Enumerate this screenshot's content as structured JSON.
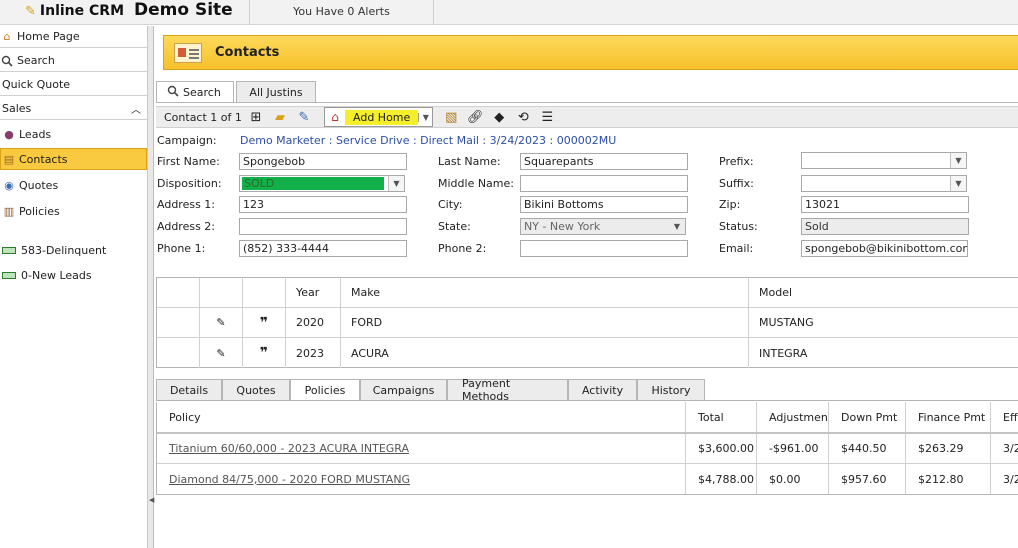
{
  "topbar": {
    "brand": "Inline CRM",
    "site": "Demo Site",
    "alerts": "You Have 0 Alerts"
  },
  "sidebar": {
    "home": "Home Page",
    "search": "Search",
    "quick_quote": "Quick Quote",
    "sales": "Sales",
    "leads": "Leads",
    "contacts": "Contacts",
    "quotes": "Quotes",
    "policies": "Policies",
    "delinquent": "583-Delinquent",
    "new_leads": "0-New Leads"
  },
  "header": {
    "title": "Contacts"
  },
  "top_tabs": {
    "search": "Search",
    "all_justins": "All Justins"
  },
  "toolbar": {
    "record": "Contact 1 of 1",
    "add_home": "Add Home"
  },
  "form": {
    "campaign_label": "Campaign:",
    "campaign_value": "Demo Marketer : Service Drive : Direct Mail : 3/24/2023 : 000002MU",
    "first_name_label": "First Name:",
    "first_name": "Spongebob",
    "last_name_label": "Last Name:",
    "last_name": "Squarepants",
    "prefix_label": "Prefix:",
    "prefix": "",
    "disposition_label": "Disposition:",
    "disposition": "SOLD",
    "middle_name_label": "Middle Name:",
    "middle_name": "",
    "suffix_label": "Suffix:",
    "suffix": "",
    "address1_label": "Address 1:",
    "address1": "123",
    "city_label": "City:",
    "city": "Bikini Bottoms",
    "zip_label": "Zip:",
    "zip": "13021",
    "address2_label": "Address 2:",
    "address2": "",
    "state_label": "State:",
    "state": "NY - New York",
    "status_label": "Status:",
    "status": "Sold",
    "phone1_label": "Phone 1:",
    "phone1": "(852) 333-4444",
    "phone2_label": "Phone 2:",
    "phone2": "",
    "email_label": "Email:",
    "email": "spongebob@bikinibottom.com"
  },
  "vehicles": {
    "headers": {
      "year": "Year",
      "make": "Make",
      "model": "Model"
    },
    "rows": [
      {
        "year": "2020",
        "make": "FORD",
        "model": "MUSTANG"
      },
      {
        "year": "2023",
        "make": "ACURA",
        "model": "INTEGRA"
      }
    ]
  },
  "bottom_tabs": [
    "Details",
    "Quotes",
    "Policies",
    "Campaigns",
    "Payment Methods",
    "Activity",
    "History"
  ],
  "policies": {
    "headers": {
      "policy": "Policy",
      "total": "Total",
      "adjustment": "Adjustment",
      "down": "Down Pmt",
      "finance": "Finance Pmt",
      "eff": "Effe"
    },
    "rows": [
      {
        "policy": "Titanium 60/60,000 - 2023 ACURA INTEGRA",
        "total": "$3,600.00",
        "adjustment": "-$961.00",
        "down": "$440.50",
        "finance": "$263.29",
        "eff": "3/2"
      },
      {
        "policy": "Diamond 84/75,000 - 2020 FORD MUSTANG",
        "total": "$4,788.00",
        "adjustment": "$0.00",
        "down": "$957.60",
        "finance": "$212.80",
        "eff": "3/2"
      }
    ]
  },
  "colors": {
    "accent": "#f7c12b",
    "sold": "#12b04a",
    "highlight": "#f5ee2a"
  }
}
